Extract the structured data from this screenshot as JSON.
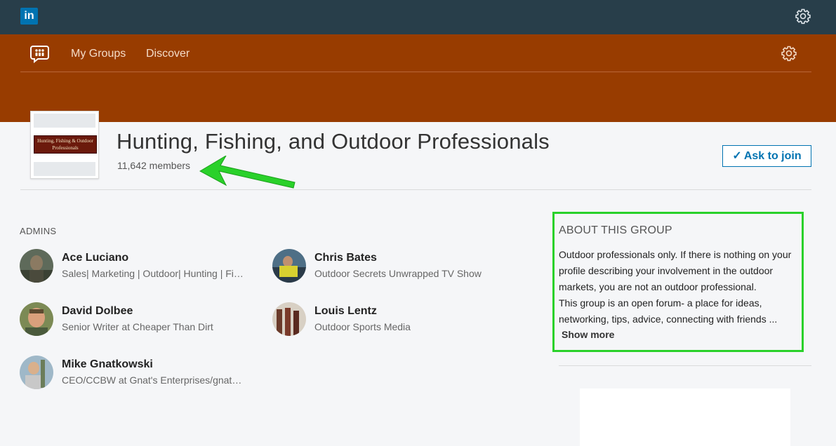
{
  "topbar": {
    "logo_text": "in",
    "logo_color": "#0073b1",
    "bg": "#283e4a",
    "icons": [
      "linkedin-logo-icon",
      "gear-icon"
    ]
  },
  "nav": {
    "my_groups": "My Groups",
    "discover": "Discover",
    "bg": "#983c00",
    "icons": [
      "groups-icon",
      "gear-icon"
    ]
  },
  "group": {
    "logo_text": "Hunting, Fishing & Outdoor Professionals",
    "title": "Hunting, Fishing, and Outdoor Professionals",
    "members": "11,642 members",
    "join_label": "Ask to join",
    "join_icon": "checkmark-icon"
  },
  "admins": {
    "label": "ADMINS",
    "items": [
      {
        "name": "Ace Luciano",
        "headline": "Sales| Marketing | Outdoor| Hunting | Fishing | Shooting"
      },
      {
        "name": "Chris Bates",
        "headline": "Outdoor Secrets Unwrapped TV Show"
      },
      {
        "name": "David Dolbee",
        "headline": "Senior Writer at Cheaper Than Dirt"
      },
      {
        "name": "Louis Lentz",
        "headline": "Outdoor Sports Media"
      },
      {
        "name": "Mike Gnatkowski",
        "headline": "CEO/CCBW at Gnat's Enterprises/gnatkowski.com"
      }
    ]
  },
  "about": {
    "title": "ABOUT THIS GROUP",
    "para1": "Outdoor professionals only. If there is nothing on your profile describing your involvement in the outdoor markets, you are not an outdoor professional.",
    "para2": "This group is an open forum- a place for ideas, networking, tips, advice, connecting with friends ...",
    "show_more": "Show more"
  },
  "annotation_color": "#2ad12a"
}
